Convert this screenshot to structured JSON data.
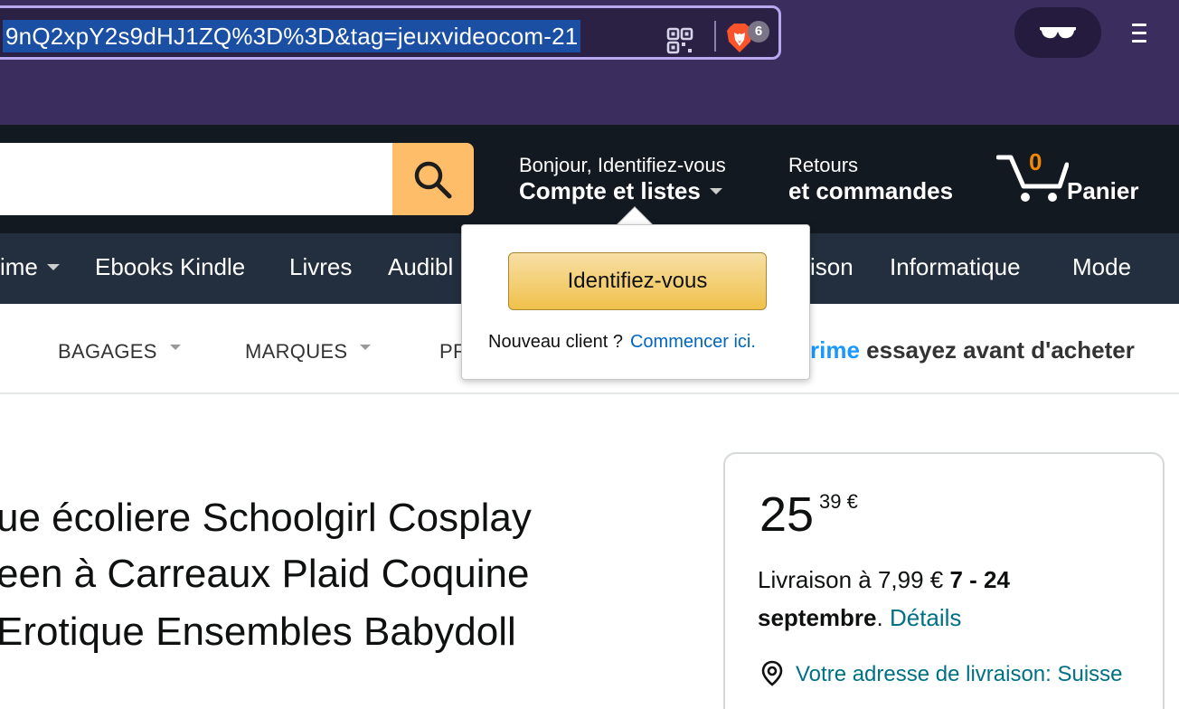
{
  "browser": {
    "url": "9nQ2xpY2s9dHJ1ZQ%3D%3D&tag=jeuxvideocom-21",
    "shields_count": "6",
    "icons": [
      "qr-code-icon",
      "brave-lion-icon",
      "incognito-glasses-icon",
      "hamburger-menu-icon"
    ],
    "colors": {
      "chrome_bg": "#3b2e5e",
      "url_highlight": "#1a4fa3"
    }
  },
  "header": {
    "account_greeting": "Bonjour, Identifiez-vous",
    "account_lists": "Compte et listes",
    "returns_line1": "Retours",
    "returns_line2": "et commandes",
    "cart_count": "0",
    "cart_label": "Panier",
    "colors": {
      "header_bg": "#131921",
      "search_button": "#febd69",
      "cart_count": "#f08804"
    }
  },
  "nav": {
    "items": [
      "ime",
      "Ebooks Kindle",
      "Livres",
      "Audibl",
      "ison",
      "Informatique",
      "Mode"
    ]
  },
  "subnav": {
    "items": [
      "BAGAGES",
      "MARQUES",
      "PR"
    ],
    "prime_word": "rime",
    "prime_tagline": "essayez avant d'acheter"
  },
  "product": {
    "title_lines": [
      "ue écoliere Schoolgirl Cosplay",
      "een à Carreaux Plaid Coquine",
      "Erotique Ensembles Babydoll"
    ]
  },
  "buybox": {
    "price_whole": "25",
    "price_fraction": "39 €",
    "delivery_prefix": "Livraison à 7,99 €",
    "delivery_dates_1": "7 - 24",
    "delivery_dates_2": "septembre",
    "details_link": "Détails",
    "address_link": "Votre adresse de livraison: Suisse"
  },
  "popover": {
    "signin_button": "Identifiez-vous",
    "new_customer": "Nouveau client ?",
    "start_link": "Commencer ici."
  }
}
